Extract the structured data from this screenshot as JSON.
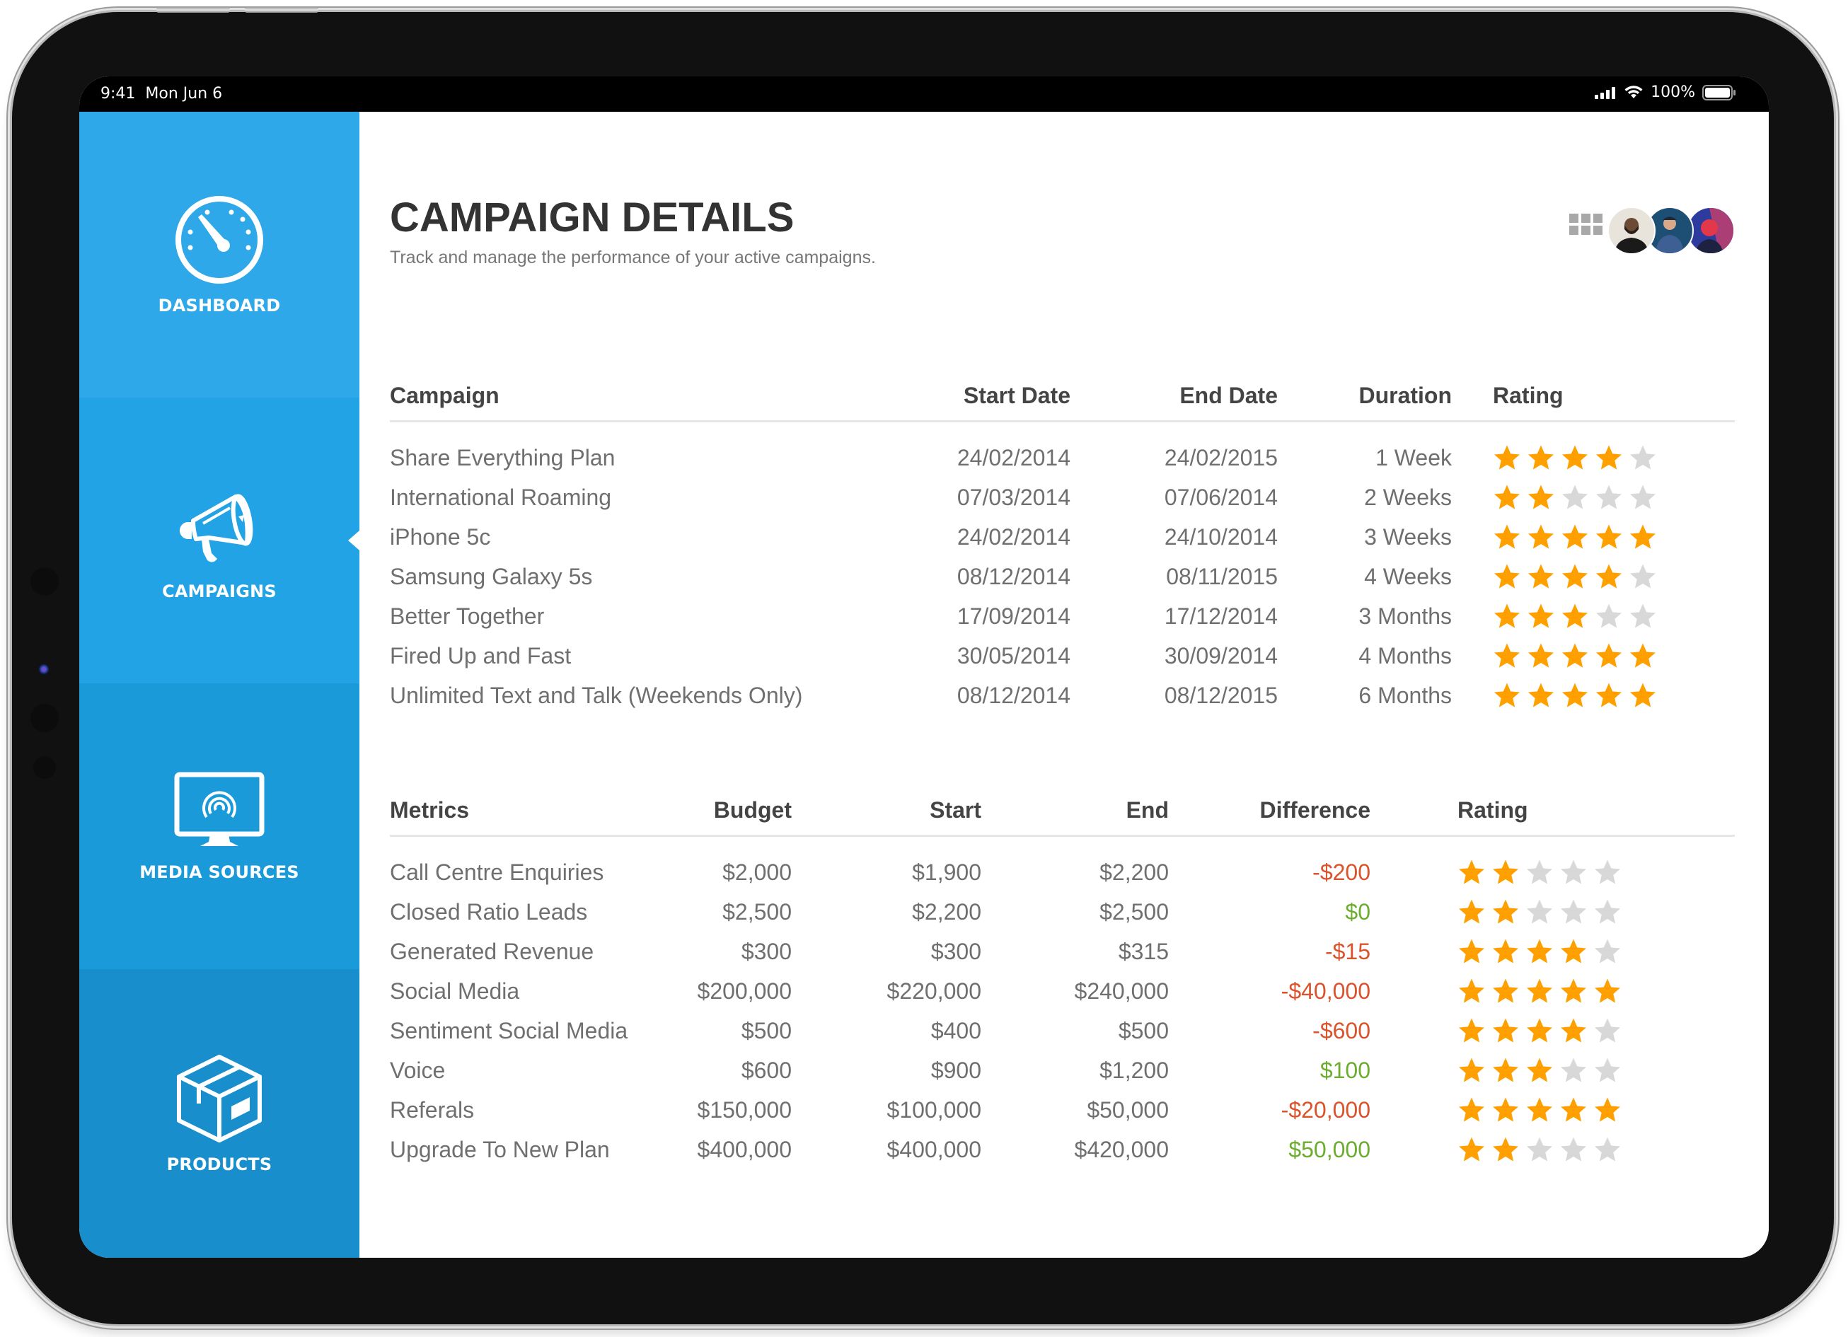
{
  "status_bar": {
    "time": "9:41",
    "date": "Mon Jun 6",
    "battery": "100%",
    "icons": [
      "signal-icon",
      "wifi-icon",
      "battery-icon"
    ]
  },
  "sidebar": {
    "items": [
      {
        "label": "DASHBOARD",
        "icon": "gauge-icon",
        "active": false,
        "color": "#2ea8e8"
      },
      {
        "label": "CAMPAIGNS",
        "icon": "megaphone-icon",
        "active": true,
        "color": "#22a3e5"
      },
      {
        "label": "MEDIA SOURCES",
        "icon": "monitor-broadcast-icon",
        "active": false,
        "color": "#1a9ad9"
      },
      {
        "label": "PRODUCTS",
        "icon": "box-icon",
        "active": false,
        "color": "#188fcc"
      }
    ]
  },
  "header": {
    "title": "CAMPAIGN DETAILS",
    "subtitle": "Track and manage the performance of your active campaigns.",
    "menu_label": "MENU",
    "avatars": [
      {
        "name": "avatar-1",
        "bg": "#e8e4dc",
        "shirt": "#1a1a1a"
      },
      {
        "name": "avatar-2",
        "bg": "#1d4f74",
        "shirt": "#3d5f93"
      },
      {
        "name": "avatar-3",
        "bg": "#3a4bb8",
        "shirt": "#e2384a"
      }
    ]
  },
  "campaigns": {
    "columns": [
      "Campaign",
      "Start Date",
      "End Date",
      "Duration",
      "Rating"
    ],
    "rows": [
      {
        "name": "Share Everything Plan",
        "start": "24/02/2014",
        "end": "24/02/2015",
        "duration": "1 Week",
        "rating": 4
      },
      {
        "name": "International Roaming",
        "start": "07/03/2014",
        "end": "07/06/2014",
        "duration": "2 Weeks",
        "rating": 2
      },
      {
        "name": "iPhone 5c",
        "start": "24/02/2014",
        "end": "24/10/2014",
        "duration": "3 Weeks",
        "rating": 5
      },
      {
        "name": "Samsung Galaxy 5s",
        "start": "08/12/2014",
        "end": "08/11/2015",
        "duration": "4 Weeks",
        "rating": 4
      },
      {
        "name": "Better Together",
        "start": "17/09/2014",
        "end": "17/12/2014",
        "duration": "3 Months",
        "rating": 3
      },
      {
        "name": "Fired Up and Fast",
        "start": "30/05/2014",
        "end": "30/09/2014",
        "duration": "4 Months",
        "rating": 5
      },
      {
        "name": "Unlimited Text and Talk (Weekends Only)",
        "start": "08/12/2014",
        "end": "08/12/2015",
        "duration": "6 Months",
        "rating": 5
      }
    ]
  },
  "metrics": {
    "columns": [
      "Metrics",
      "Budget",
      "Start",
      "End",
      "Difference",
      "Rating"
    ],
    "rows": [
      {
        "name": "Call Centre Enquiries",
        "budget": "$2,000",
        "start": "$1,900",
        "end": "$2,200",
        "difference": "-$200",
        "trend": "negative",
        "rating": 2
      },
      {
        "name": "Closed Ratio Leads",
        "budget": "$2,500",
        "start": "$2,200",
        "end": "$2,500",
        "difference": "$0",
        "trend": "positive",
        "rating": 2
      },
      {
        "name": "Generated Revenue",
        "budget": "$300",
        "start": "$300",
        "end": "$315",
        "difference": "-$15",
        "trend": "negative",
        "rating": 4
      },
      {
        "name": "Social Media",
        "budget": "$200,000",
        "start": "$220,000",
        "end": "$240,000",
        "difference": "-$40,000",
        "trend": "negative",
        "rating": 5
      },
      {
        "name": "Sentiment Social Media",
        "budget": "$500",
        "start": "$400",
        "end": "$500",
        "difference": "-$600",
        "trend": "negative",
        "rating": 4
      },
      {
        "name": "Voice",
        "budget": "$600",
        "start": "$900",
        "end": "$1,200",
        "difference": "$100",
        "trend": "positive",
        "rating": 3
      },
      {
        "name": "Referals",
        "budget": "$150,000",
        "start": "$100,000",
        "end": "$50,000",
        "difference": "-$20,000",
        "trend": "negative",
        "rating": 5
      },
      {
        "name": "Upgrade To New Plan",
        "budget": "$400,000",
        "start": "$400,000",
        "end": "$420,000",
        "difference": "$50,000",
        "trend": "positive",
        "rating": 2
      }
    ]
  },
  "rating_max": 5,
  "colors": {
    "star_on": "#FFA000",
    "star_off": "#D8D8D8",
    "negative": "#D9532C",
    "positive": "#6CAC2E",
    "title": "#333333",
    "text": "#6F6F6F"
  }
}
